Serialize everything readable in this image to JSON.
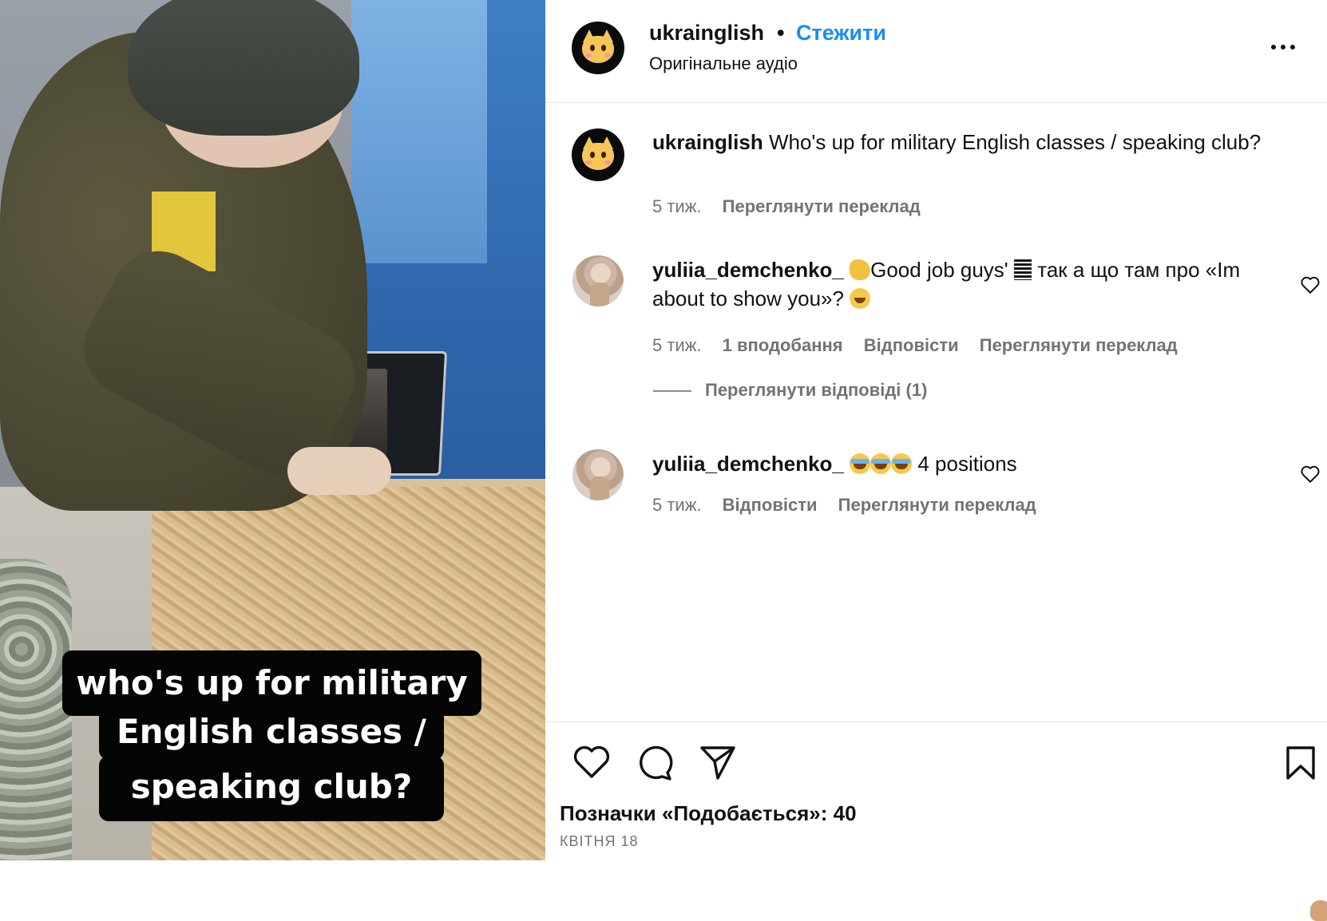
{
  "video": {
    "caption_lines": [
      "who's up for military",
      "English classes /",
      "speaking club?"
    ]
  },
  "header": {
    "username": "ukrainglish",
    "separator": "•",
    "follow_label": "Стежити",
    "audio_label": "Оригінальне аудіо",
    "more_icon": "more-horizontal-icon"
  },
  "post_caption": {
    "username": "ukrainglish",
    "text": "Who's up for military English classes / speaking club?",
    "time": "5 тиж.",
    "translate_label": "Переглянути переклад"
  },
  "comments": [
    {
      "username": "yuliia_demchenko_",
      "text_part1": "Good job guys'",
      "text_part2": "так а що там про «Im about to show you»?",
      "time": "5 тиж.",
      "likes_label": "1 вподобання",
      "reply_label": "Відповісти",
      "translate_label": "Переглянути переклад",
      "view_replies_label": "Переглянути відповіді (1)"
    },
    {
      "username": "yuliia_demchenko_",
      "text": "4 positions",
      "time": "5 тиж.",
      "reply_label": "Відповісти",
      "translate_label": "Переглянути переклад"
    }
  ],
  "actions": {
    "like_icon": "heart-icon",
    "comment_icon": "comment-icon",
    "share_icon": "paper-plane-icon",
    "save_icon": "bookmark-icon"
  },
  "likes_text": "Позначки «Подобається»: 40",
  "date_text": "КВІТНЯ 18",
  "colors": {
    "accent": "#1a8cf2",
    "meta_text": "#737373",
    "divider": "#e6e6e6"
  }
}
